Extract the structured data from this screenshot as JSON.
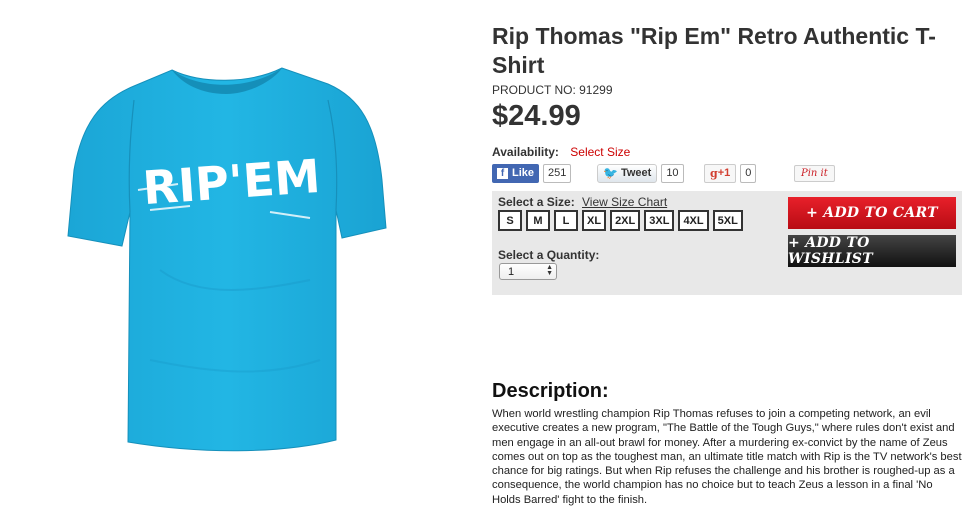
{
  "product": {
    "title": "Rip Thomas \"Rip Em\" Retro Authentic T-Shirt",
    "product_no": "PRODUCT NO: 91299",
    "price": "$24.99",
    "shirt_text": "RIP'EM",
    "shirt_color": "#1fb1e0"
  },
  "availability": {
    "label": "Availability:",
    "value": "Select Size"
  },
  "social": {
    "facebook_label": "Like",
    "facebook_count": "251",
    "twitter_label": "Tweet",
    "twitter_count": "10",
    "gplus_label": "+1",
    "gplus_count": "0",
    "pinterest_label": "Pin it"
  },
  "options": {
    "size_label": "Select a Size:",
    "size_chart_link": "View Size Chart",
    "sizes": [
      "S",
      "M",
      "L",
      "XL",
      "2XL",
      "3XL",
      "4XL",
      "5XL"
    ],
    "quantity_label": "Select a Quantity:",
    "quantity_value": "1"
  },
  "actions": {
    "add_to_cart": "+ ADD TO CART",
    "add_to_wishlist": "+ ADD TO WISHLIST"
  },
  "description": {
    "title": "Description:",
    "text": "When world wrestling champion Rip Thomas refuses to join a competing network, an evil executive creates a new program, \"The Battle of the Tough Guys,\" where rules don't exist and men engage in an all-out brawl for money. After a murdering ex-convict by the name of Zeus comes out on top as the toughest man, an ultimate title match with Rip is the TV network's best chance for big ratings. But when Rip refuses the challenge and his brother is roughed-up as a consequence, the world champion has no choice but to teach Zeus a lesson in a final 'No Holds Barred' fight to the finish."
  }
}
